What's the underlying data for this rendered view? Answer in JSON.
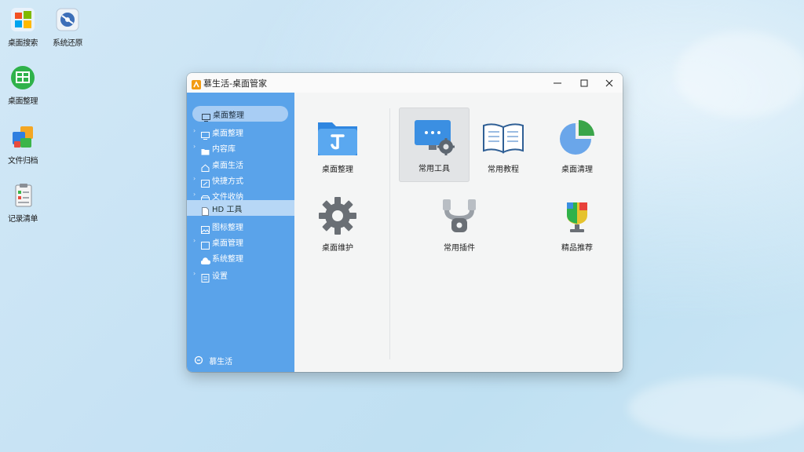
{
  "desktop": {
    "icons": [
      {
        "label": "桌面搜索",
        "icon": "windows-logo-icon"
      },
      {
        "label": "系统还原",
        "icon": "restore-disc-icon"
      },
      {
        "label": "桌面整理",
        "icon": "desktop-organize-icon"
      },
      {
        "label": "文件归档",
        "icon": "file-archive-icon"
      },
      {
        "label": "记录清单",
        "icon": "clipboard-checklist-icon"
      }
    ]
  },
  "window": {
    "title": "慕生活-桌面管家",
    "sidebar": {
      "items": [
        {
          "label": "桌面整理",
          "icon": "desktop-icon",
          "expandable": false
        },
        {
          "label": "桌面整理",
          "icon": "desktop-icon",
          "expandable": true
        },
        {
          "label": "内容库",
          "icon": "folder-icon",
          "expandable": true
        },
        {
          "label": "桌面生活",
          "icon": "home-icon",
          "expandable": false
        },
        {
          "label": "快捷方式",
          "icon": "shortcut-icon",
          "expandable": true
        },
        {
          "label": "文件收纳",
          "icon": "box-icon",
          "expandable": true
        },
        {
          "label": "HD 工具",
          "icon": "document-icon",
          "expandable": false
        },
        {
          "label": "图标整理",
          "icon": "image-icon",
          "expandable": false
        },
        {
          "label": "桌面管理",
          "icon": "window-icon",
          "expandable": true
        },
        {
          "label": "系统整理",
          "icon": "cloud-icon",
          "expandable": false
        },
        {
          "label": "设置",
          "icon": "settings-doc-icon",
          "expandable": true
        }
      ],
      "footer": "慕生活"
    },
    "tiles": [
      {
        "label": "桌面整理",
        "icon": "blue-folder-icon"
      },
      {
        "label": "常用工具",
        "icon": "monitor-gear-icon"
      },
      {
        "label": "常用教程",
        "icon": "open-book-icon"
      },
      {
        "label": "桌面清理",
        "icon": "pie-chart-icon"
      },
      {
        "label": "桌面维护",
        "icon": "gear-icon"
      },
      {
        "label": "常用插件",
        "icon": "tool-connector-icon"
      },
      {
        "label": "精品推荐",
        "icon": "trophy-icon"
      }
    ]
  },
  "colors": {
    "sidebar": "#5aa3ea",
    "accent": "#3d8fe0",
    "background": "#c6e2f4"
  }
}
